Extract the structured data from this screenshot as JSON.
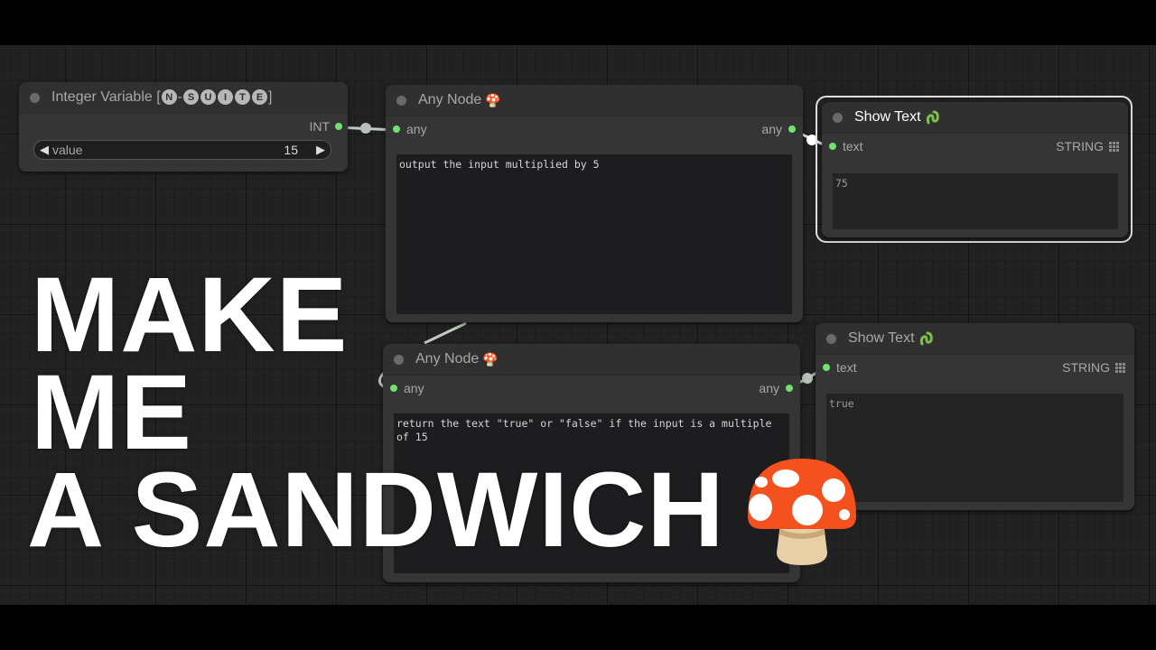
{
  "overlay_text": {
    "line1": "MAKE",
    "line2": "ME",
    "line3": "A SANDWICH"
  },
  "nodes": {
    "integer_variable": {
      "title_prefix": "Integer Variable [",
      "badge_n": "N",
      "badge_sep": "-",
      "badges": [
        "S",
        "U",
        "I",
        "T",
        "E"
      ],
      "title_suffix": "]",
      "output_label": "INT",
      "widget_name": "value",
      "widget_value": "15",
      "left_arrow": "◀",
      "right_arrow": "▶"
    },
    "any_node_1": {
      "title": "Any Node",
      "title_icon": "🍄",
      "input_label": "any",
      "output_label": "any",
      "prompt": "output the input multiplied by 5"
    },
    "any_node_2": {
      "title": "Any Node",
      "title_icon": "🍄",
      "input_label": "any",
      "output_label": "any",
      "prompt": "return the text \"true\" or \"false\" if the input is a multiple of 15"
    },
    "show_text_1": {
      "title": "Show Text",
      "title_icon": "snake-icon",
      "input_label": "text",
      "output_label": "STRING",
      "value": "75"
    },
    "show_text_2": {
      "title": "Show Text",
      "title_icon": "snake-icon",
      "input_label": "text",
      "output_label": "STRING",
      "value": "true"
    }
  },
  "colors": {
    "slot_green": "#6fe26f",
    "mushroom_cap": "#f4511e",
    "mushroom_stem": "#e8cfa6",
    "snake_green": "#7cc04a"
  }
}
